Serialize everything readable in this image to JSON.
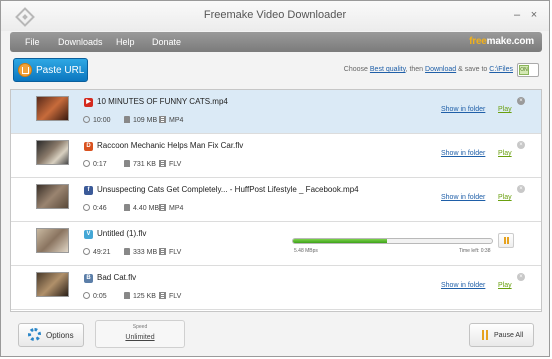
{
  "window": {
    "title": "Freemake Video Downloader",
    "minimize": "–",
    "close": "×"
  },
  "menu": {
    "items": [
      "File",
      "Downloads",
      "Help",
      "Donate"
    ],
    "brand_free": "free",
    "brand_rest": "make.com"
  },
  "toolbar": {
    "paste_label": "Paste URL",
    "choose_prefix": "Choose",
    "quality": "Best quality",
    "then": ", then",
    "action": "Download",
    "save_to": "& save to",
    "folder": "C:\\Files",
    "toggle_label": "ON"
  },
  "colors": {
    "accent": "#1b8ad3",
    "progress": "#4fb52a",
    "link": "#1f5fa8",
    "play": "#6aa00f"
  },
  "downloads": [
    {
      "source": "youtube",
      "source_glyph": "▶",
      "source_color": "#d42a1e",
      "title": "10 MINUTES OF FUNNY CATS.mp4",
      "duration": "10:00",
      "size": "109 MB",
      "format": "MP4",
      "show_folder": "Show in folder",
      "play": "Play",
      "selected": true
    },
    {
      "source": "dailymotion",
      "source_glyph": "D",
      "source_color": "#d9521f",
      "title": "Raccoon Mechanic Helps Man Fix Car.flv",
      "duration": "0:17",
      "size": "731 KB",
      "format": "FLV",
      "show_folder": "Show in folder",
      "play": "Play"
    },
    {
      "source": "facebook",
      "source_glyph": "f",
      "source_color": "#3b5a98",
      "title": "Unsuspecting Cats Get Completely... - HuffPost Lifestyle _ Facebook.mp4",
      "duration": "0:46",
      "size": "4.40 MB",
      "format": "MP4",
      "show_folder": "Show in folder",
      "play": "Play"
    },
    {
      "source": "vimeo",
      "source_glyph": "V",
      "source_color": "#44a7d6",
      "title": "Untitled (1).flv",
      "duration": "49:21",
      "size": "333 MB",
      "format": "FLV",
      "progress": 0.47,
      "speed_text": "5.48  MBps",
      "time_left": "Time left: 0:38"
    },
    {
      "source": "bliptv",
      "source_glyph": "B",
      "source_color": "#5b7ea8",
      "title": "Bad Cat.flv",
      "duration": "0:05",
      "size": "125 KB",
      "format": "FLV",
      "show_folder": "Show in folder",
      "play": "Play"
    }
  ],
  "bottom": {
    "options_label": "Options",
    "speed_caption": "Speed",
    "speed_value": "Unlimited",
    "pause_all_label": "Pause All"
  }
}
